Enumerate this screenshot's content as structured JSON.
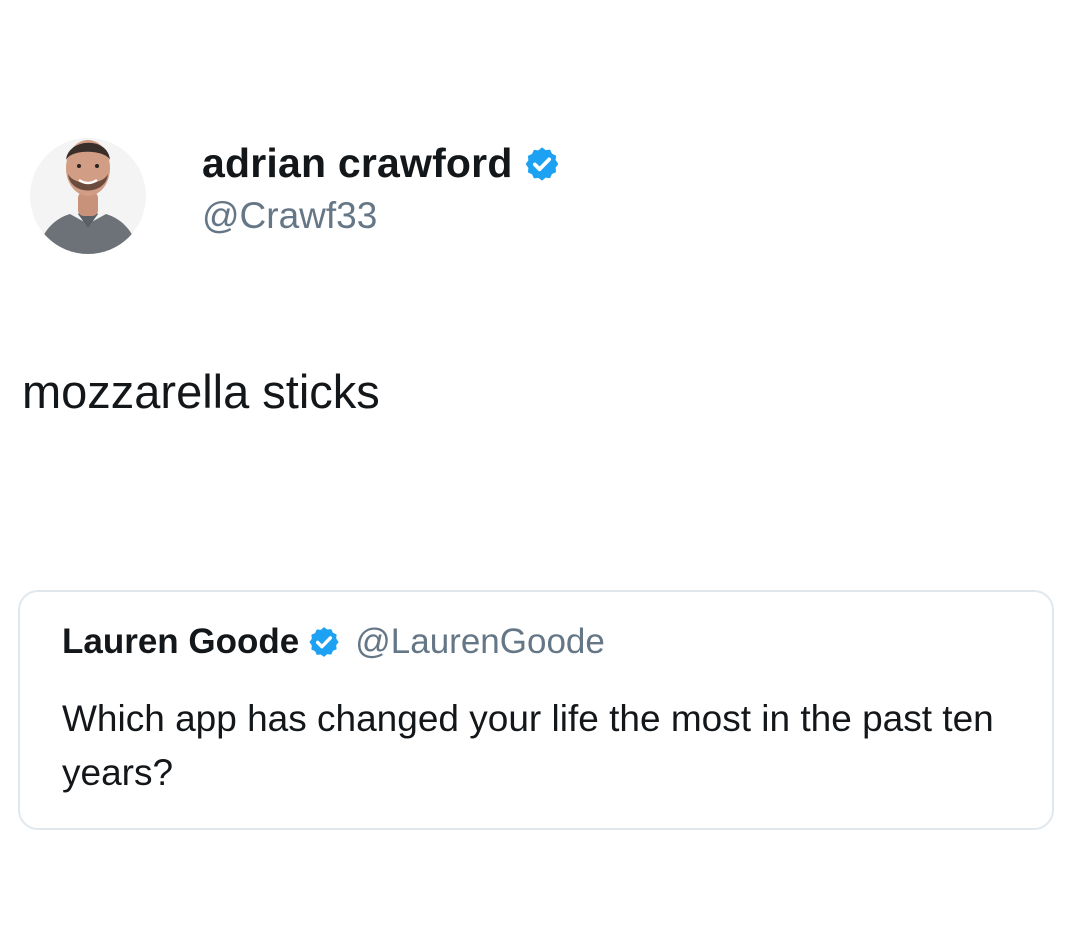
{
  "tweet": {
    "author": {
      "display_name": "adrian crawford",
      "handle": "@Crawf33",
      "verified_icon": "verified-badge-icon"
    },
    "text": "mozzarella sticks",
    "quoted_tweet": {
      "display_name": "Lauren Goode",
      "handle": "@LaurenGoode",
      "verified_icon": "verified-badge-icon",
      "text": "Which app has changed your life the most in the past ten years?"
    }
  },
  "colors": {
    "verified_blue": "#1da1f2",
    "text_primary": "#14171a",
    "text_secondary": "#657786",
    "card_border": "#e1e8ed"
  }
}
